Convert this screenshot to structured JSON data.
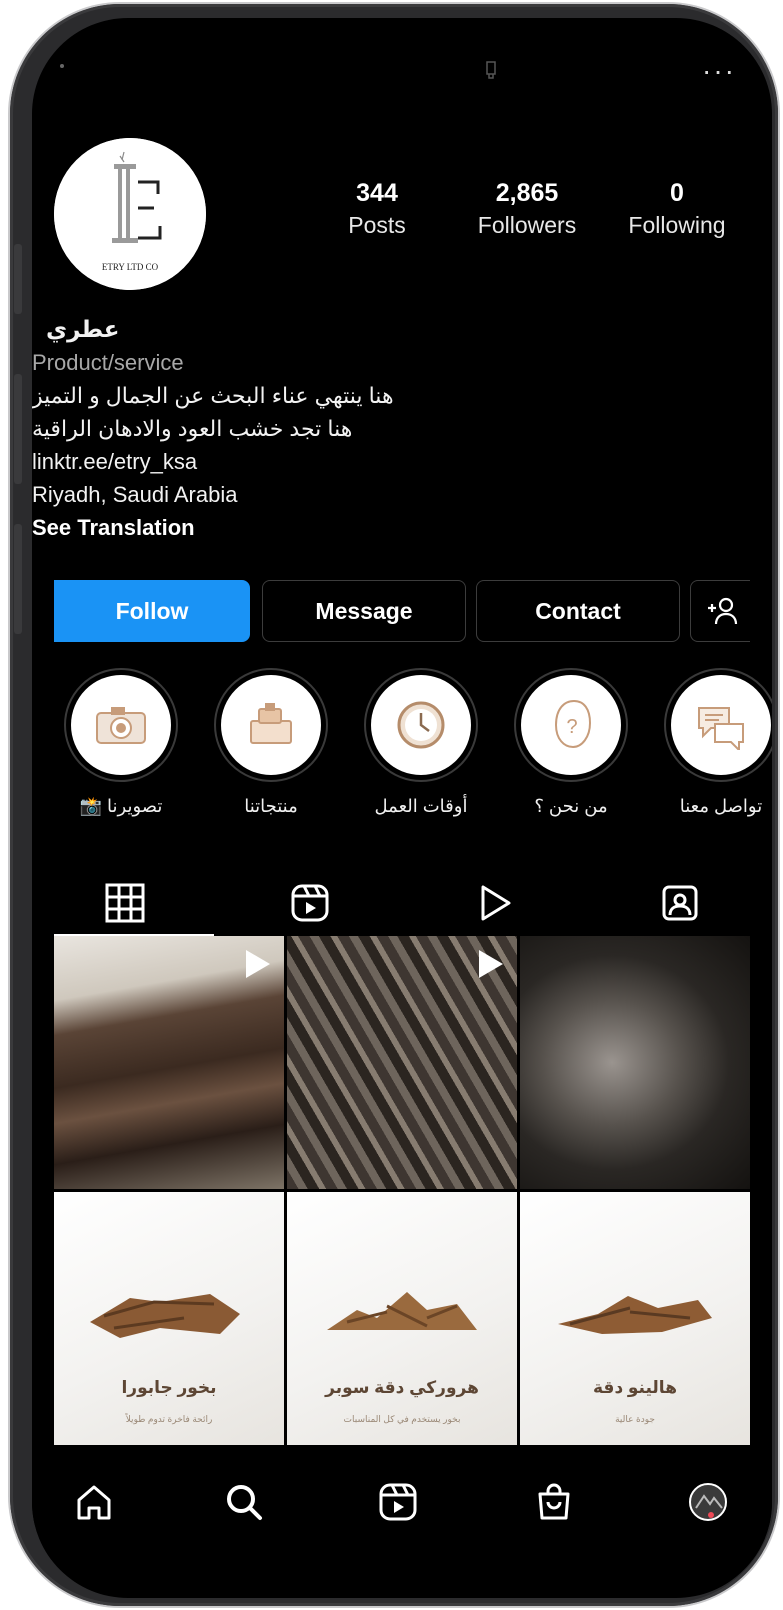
{
  "profile": {
    "username": "عطري",
    "category": "Product/service",
    "bio_line1": "هنا ينتهي عناء البحث عن الجمال و التميز",
    "bio_line2": "هنا تجد خشب العود والادهان الراقية",
    "link": "linktr.ee/etry_ksa",
    "location": "Riyadh, Saudi Arabia",
    "see_translation": "See Translation",
    "avatar_logo_text": "ETRY LTD CO"
  },
  "stats": [
    {
      "value": "344",
      "label": "Posts"
    },
    {
      "value": "2,865",
      "label": "Followers"
    },
    {
      "value": "0",
      "label": "Following"
    }
  ],
  "buttons": {
    "follow": "Follow",
    "message": "Message",
    "contact": "Contact"
  },
  "highlights": [
    {
      "label": "تصويرنا 📸",
      "icon": "camera-icon"
    },
    {
      "label": "منتجاتنا",
      "icon": "products-icon"
    },
    {
      "label": "أوقات العمل",
      "icon": "clock-icon"
    },
    {
      "label": "من نحن ؟",
      "icon": "person-question-icon"
    },
    {
      "label": "تواصل معنا",
      "icon": "chat-bubbles-icon"
    }
  ],
  "tabs": [
    "grid-icon",
    "reels-icon",
    "video-play-icon",
    "tagged-icon"
  ],
  "posts": [
    {
      "type": "video",
      "style": "photo1"
    },
    {
      "type": "video",
      "style": "photo2"
    },
    {
      "type": "image",
      "style": "photo3"
    },
    {
      "type": "image",
      "style": "product",
      "title": "بخور جابورا",
      "subtitle": "رائحة فاخرة تدوم طويلاً"
    },
    {
      "type": "image",
      "style": "product",
      "title": "هروركي دقة سوبر",
      "subtitle": "بخور يستخدم في كل المناسبات"
    },
    {
      "type": "image",
      "style": "product",
      "title": "هالينو دقة",
      "subtitle": "جودة عالية"
    }
  ],
  "colors": {
    "accent": "#1a93f5",
    "background": "#000000",
    "notification": "#ed4956"
  }
}
